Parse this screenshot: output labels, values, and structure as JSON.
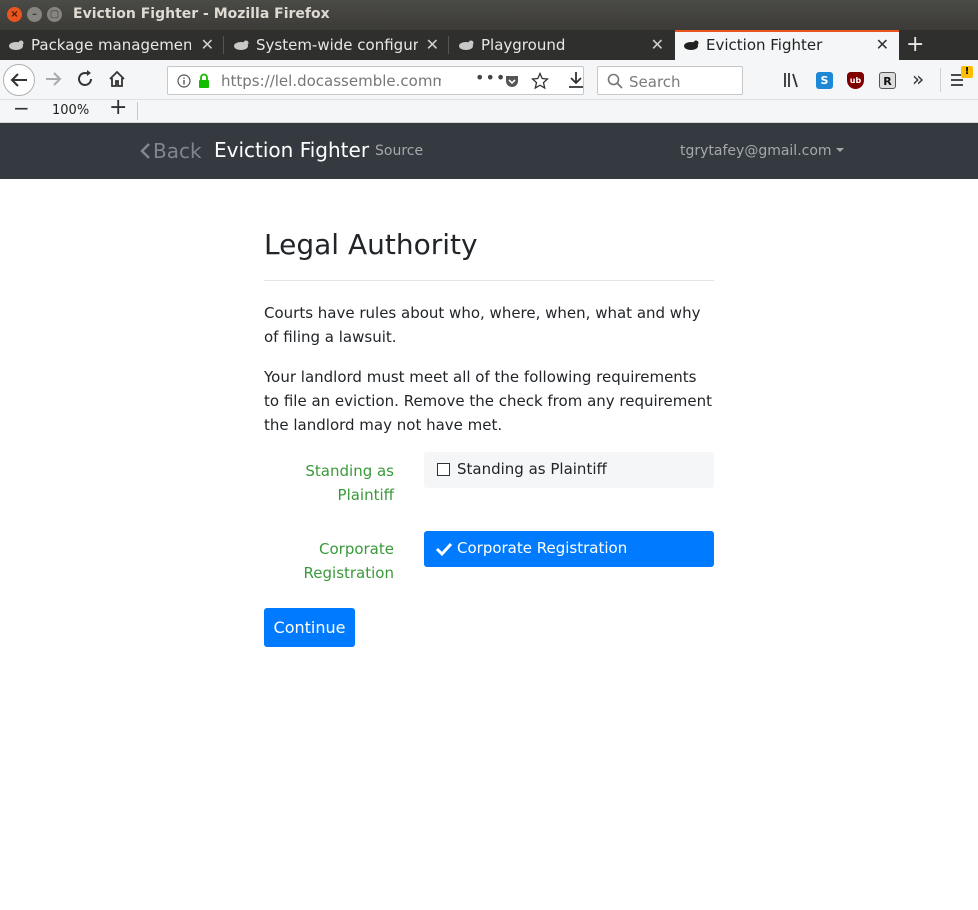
{
  "window": {
    "title": "Eviction Fighter - Mozilla Firefox"
  },
  "tabs": [
    {
      "label": "Package management",
      "active": false
    },
    {
      "label": "System-wide configurat",
      "active": false
    },
    {
      "label": "Playground",
      "active": false
    },
    {
      "label": "Eviction Fighter",
      "active": true
    }
  ],
  "toolbar": {
    "url": "https://lel.docassemble.commu",
    "search_placeholder": "Search",
    "zoom_level": "100%"
  },
  "extensions": {
    "s_label": "S",
    "ub_label": "ub",
    "r_label": "R"
  },
  "app_header": {
    "back_label": "Back",
    "brand": "Eviction Fighter",
    "source_label": "Source",
    "user_email": "tgrytafey@gmail.com"
  },
  "page": {
    "heading": "Legal Authority",
    "intro": "Courts have rules about who, where, when, what and why of filing a lawsuit.",
    "instructions": "Your landlord must meet all of the following requirements to file an eviction. Remove the check from any requirement the landlord may not have met.",
    "fields": [
      {
        "label": "Standing as Plaintiff",
        "checkbox_label": "Standing as Plaintiff",
        "checked": false
      },
      {
        "label": "Corporate Registration",
        "checkbox_label": "Corporate Registration",
        "checked": true
      }
    ],
    "continue_label": "Continue"
  },
  "colors": {
    "app_header_bg": "#343a40",
    "primary": "#007bff",
    "label_green": "#3a9a3a",
    "tab_accent": "#e9541f"
  }
}
